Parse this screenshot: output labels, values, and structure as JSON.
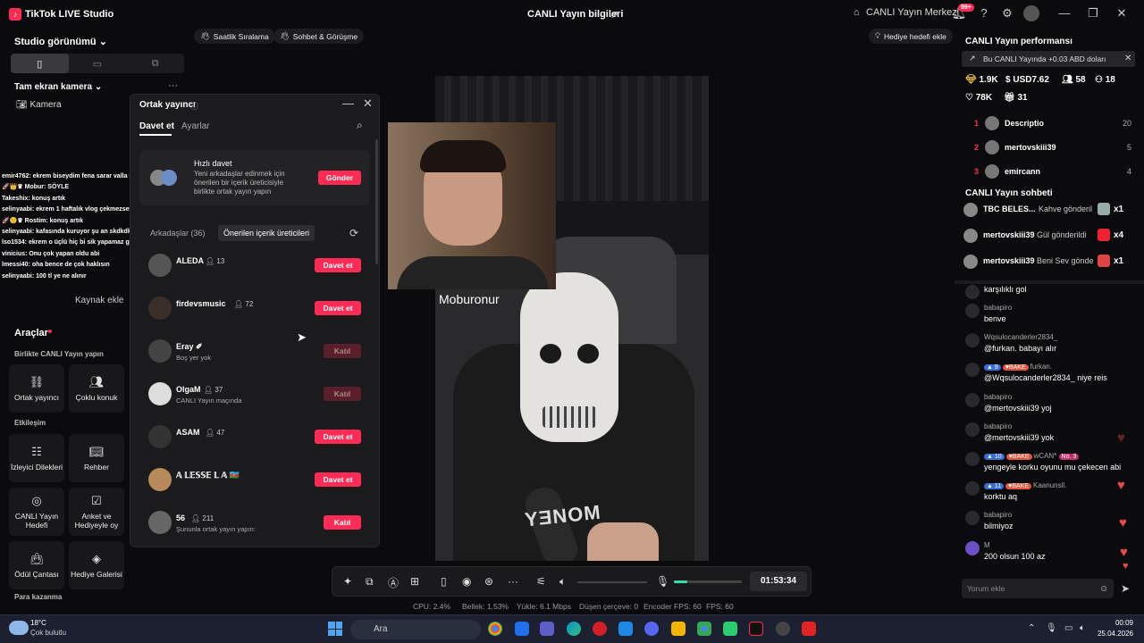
{
  "titlebar": {
    "app": "TikTok LIVE Studio",
    "center": "CANLI Yayın bilgileri",
    "center_link": "CANLI Yayın Merkezi",
    "badge": "99+"
  },
  "left": {
    "studio_view": "Studio görünümü",
    "fullscreen_camera": "Tam ekran kamera",
    "camera_source": "Kamera",
    "add_source": "Kaynak ekle",
    "chat_overlay": [
      "emir4762: ekrem biseydim fena sarar valla saat 3 te kadar açarsan",
      "🚀👑♛ Mobur: SÖYLE",
      "Takeshix: konuş artık",
      "selinyaabi: ekrem 1 haftalık vlog çekmezsen sana fena şeyler yapacaz",
      "🚀🙂♛ Rostim: konuş artık",
      "selinyaabi: kafasında kuruyor şu an skdkdkdk",
      "lso1534: ekrem o üçlü hiç bi sik yapamaz gibi ama neyse",
      "vinicius: Onu çok yapan oldu abi",
      "lmessi40: oha bence de çok haklısın",
      "selinyaabi: 100 tl ye ne alınır"
    ],
    "tools_title": "Araçlar",
    "together_label": "Birlikte CANLI Yayın yapın",
    "interaction_label": "Etkileşim",
    "money_label": "Para kazanma",
    "tools": [
      {
        "label": "Ortak yayıncı"
      },
      {
        "label": "Çoklu konuk"
      },
      {
        "label": "İzleyici Dilekleri"
      },
      {
        "label": "Rehber"
      },
      {
        "label": "CANLI Yayın Hedefi"
      },
      {
        "label": "Anket ve Hediyeyle oy"
      },
      {
        "label": "Ödül Çantası"
      },
      {
        "label": "Hediye Galerisi"
      }
    ]
  },
  "top_chips": {
    "ranking": "Saatlik Sıralama",
    "chat": "Sohbet & Görüşme",
    "gift_goal": "Hediye hedefi ekle"
  },
  "modal": {
    "title": "Ortak yayıncı",
    "tab_invite": "Davet et",
    "tab_settings": "Ayarlar",
    "quick_title": "Hızlı davet",
    "quick_desc": "Yeni arkadaşlar edinmek için önerilen bir içerik üreticisiyle birlikte ortak yayın yapın",
    "send": "Gönder",
    "friends_tab": "Arkadaşlar (36)",
    "suggested_tab": "Önerilen içerik üreticileri",
    "rows": [
      {
        "name": "ALEDA",
        "count": "13",
        "sub": "",
        "action": "Davet et",
        "enabled": true
      },
      {
        "name": "firdevsmusic",
        "count": "72",
        "sub": "",
        "action": "Davet et",
        "enabled": true
      },
      {
        "name": "Eray ✐",
        "count": "",
        "sub": "Boş yer yok",
        "action": "Katıl",
        "enabled": false
      },
      {
        "name": "OlgaM",
        "count": "37",
        "sub": "CANLI Yayın maçında",
        "action": "Katıl",
        "enabled": false
      },
      {
        "name": "ASAM",
        "count": "47",
        "sub": "",
        "action": "Davet et",
        "enabled": true
      },
      {
        "name": "𝔸 𝕃𝔼𝕊𝕊𝔼 𝕃 𝔸 🇦🇿",
        "count": "",
        "sub": "",
        "action": "Davet et",
        "enabled": true
      },
      {
        "name": "56",
        "count": "211",
        "sub": "Şununla ortak yayın yapın:",
        "action": "Katıl",
        "enabled": true
      }
    ]
  },
  "video": {
    "guest_name": "Moburonur",
    "shirt_text": "YƎNOM"
  },
  "controls": {
    "timer": "01:53:34",
    "mic_level": 0.2
  },
  "stats": {
    "cpu": "CPU: 2.4%",
    "mem": "Bellek: 1.53%",
    "upload": "Yükle: 6.1 Mbps",
    "drop": "Düşen çerçeve: 0",
    "enc": "Encoder FPS: 60",
    "fps": "FPS: 60"
  },
  "right": {
    "perf_title": "CANLI Yayın performansı",
    "banner": "Bu CANLI Yayında +0.03 ABD doları",
    "stat_diamonds": "1.9K",
    "stat_usd": "USD7.62",
    "stat_users": "58",
    "stat_people": "18",
    "stat_likes": "78K",
    "stat_gifts": "31",
    "ranking": [
      {
        "n": "1",
        "name": "Descriptio",
        "v": "20"
      },
      {
        "n": "2",
        "name": "mertovskiii39",
        "v": "5"
      },
      {
        "n": "3",
        "name": "emircann",
        "v": "4"
      }
    ],
    "chat_title": "CANLI Yayın sohbeti",
    "gifts": [
      {
        "name": "TBC BELES...",
        "text": "Kahve gönderil",
        "x": "x1"
      },
      {
        "name": "mertovskiii39",
        "text": "Gül gönderildi",
        "x": "x4"
      },
      {
        "name": "mertovskiii39",
        "text": "Beni Sev gönde",
        "x": "x1"
      }
    ],
    "messages": [
      {
        "user": "",
        "text": "karşılıklı gol"
      },
      {
        "user": "babapiro",
        "text": "benve"
      },
      {
        "user": "Wqsulocanderler2834_",
        "text": "@furkan. babayı alır"
      },
      {
        "user": "furkan.",
        "text": "@Wqsulocanderler2834_ niye reis",
        "lvl": "9",
        "tag": "BAKE"
      },
      {
        "user": "babapiro",
        "text": "@mertovskiii39 yoj"
      },
      {
        "user": "babapiro",
        "text": "@mertovskiii39 yok"
      },
      {
        "user": "wCAN*",
        "text": "yengeyle korku oyunu mu çekecen abi",
        "lvl": "10",
        "tag": "BAKE",
        "tag2": "No. 3"
      },
      {
        "user": "Kaanunsll.",
        "text": "korktu aq",
        "lvl": "11",
        "tag": "BAKE"
      },
      {
        "user": "babapiro",
        "text": "bilmiyoz"
      },
      {
        "user": "M",
        "text": "200 olsun 100 az"
      }
    ],
    "input_placeholder": "Yorum ekle"
  },
  "taskbar": {
    "temp": "18°C",
    "weather": "Çok bulutlu",
    "search": "Ara",
    "time": "00:09",
    "date": "25.04.2026"
  },
  "colors": {
    "accent": "#fe2c55",
    "bg": "#0b0b0d",
    "panel": "#1b1b1e"
  }
}
